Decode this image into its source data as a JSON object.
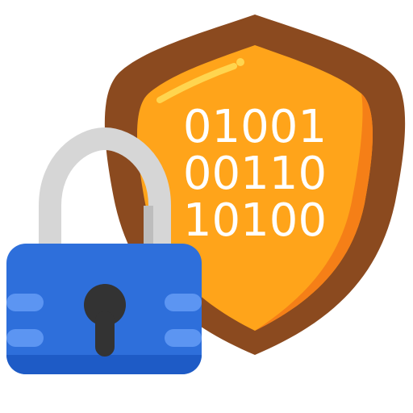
{
  "icon": {
    "name": "data-security-icon",
    "binary_lines": [
      "01001",
      "00110",
      "10100"
    ]
  },
  "colors": {
    "shield_outer": "#8B4A1F",
    "shield_inner": "#FFA41A",
    "shield_inner_shadow": "#F57F17",
    "shield_highlight": "#FFD54F",
    "binary_text": "#FFFFFF",
    "shackle": "#D6D6D6",
    "shackle_shadow": "#BDBDBD",
    "lock_body": "#2E6FDB",
    "lock_body_bottom": "#1E5BC6",
    "lock_stripes": "#5C95F2",
    "keyhole": "#333333"
  }
}
